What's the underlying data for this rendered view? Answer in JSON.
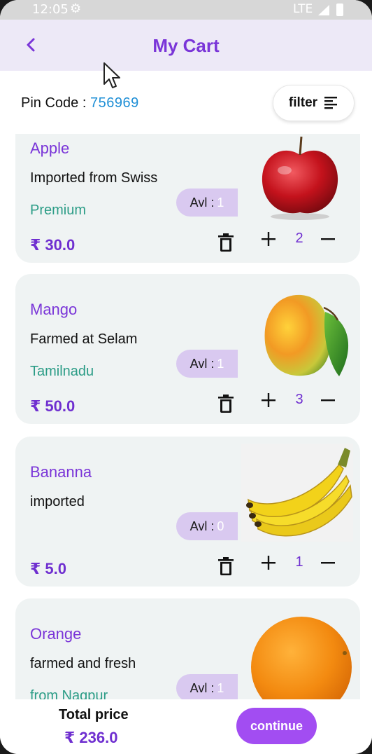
{
  "status_bar": {
    "time": "12:05",
    "network": "LTE",
    "icons": [
      "gear-icon",
      "signal-icon",
      "battery-icon"
    ]
  },
  "app_bar": {
    "title": "My Cart",
    "back_icon": "chevron-left-icon"
  },
  "pin": {
    "label": "Pin Code : ",
    "value": "756969"
  },
  "filter": {
    "label": "filter",
    "icon": "sort-lines-icon"
  },
  "currency": "₹",
  "colors": {
    "accent": "#7a35d8",
    "price": "#6f2fd0",
    "origin": "#2b9c86",
    "button": "#a24df2",
    "avl_bg": "#d9c9f0",
    "pin": "#1f8fd6"
  },
  "items": [
    {
      "name": "Apple",
      "description": "Imported from Swiss",
      "origin": "Premium",
      "avl_label": "Avl :",
      "avl": "1",
      "price": "₹ 30.0",
      "qty": "2",
      "image": "apple"
    },
    {
      "name": "Mango",
      "description": "Farmed at Selam",
      "origin": "Tamilnadu",
      "avl_label": "Avl :",
      "avl": "1",
      "price": "₹ 50.0",
      "qty": "3",
      "image": "mango"
    },
    {
      "name": "Bananna",
      "description": "imported",
      "origin": "",
      "avl_label": "Avl :",
      "avl": "0",
      "price": "₹ 5.0",
      "qty": "1",
      "image": "banana"
    },
    {
      "name": "Orange",
      "description": "farmed and fresh",
      "origin": "from Nagpur",
      "avl_label": "Avl :",
      "avl": "1",
      "price": "",
      "qty": "",
      "image": "orange"
    }
  ],
  "footer": {
    "total_label": "Total price",
    "total_value": "₹ 236.0",
    "continue_label": "continue"
  }
}
